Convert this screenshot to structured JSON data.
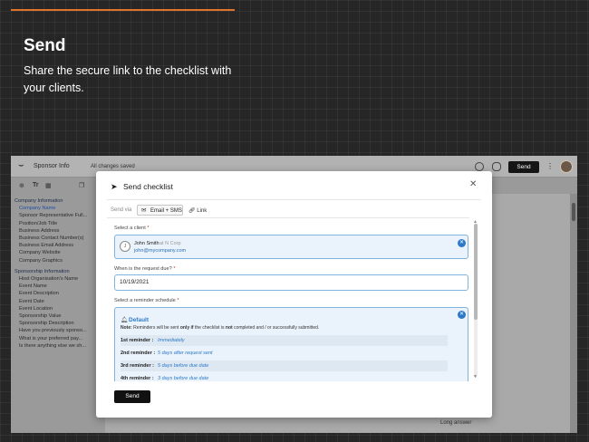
{
  "hero": {
    "title": "Send",
    "subtitle": "Share the secure link to the checklist with your clients."
  },
  "colors": {
    "accent": "#e0732c",
    "primary_blue": "#2d79c7"
  },
  "app": {
    "doc_title": "Sponsor Info",
    "saved_status": "All changes saved",
    "send_label": "Send",
    "menu_icon": "kebab-icon",
    "toolbar": {
      "text_tool": "Tr"
    }
  },
  "sidebar": {
    "sections": [
      {
        "title": "Company Information",
        "items": [
          "Company Name",
          "Sponsor Representative Full...",
          "Position/Job Title",
          "Business Address",
          "Business Contact Number(s)",
          "Business Email Address",
          "Company Website",
          "Company Graphics"
        ]
      },
      {
        "title": "Sponsorship Information",
        "items": [
          "Host Organisation's Name",
          "Event Name",
          "Event Description",
          "Event Date",
          "Event Location",
          "Sponsorship Value",
          "Sponsorship Description",
          "Have you previously sponso...",
          "What is your preferred pay...",
          "Is there anything else we sh..."
        ]
      }
    ]
  },
  "background": {
    "long_answer": "Long answer"
  },
  "modal": {
    "title": "Send checklist",
    "send_via_label": "Send via",
    "tabs": {
      "email_sms": "Email + SMS",
      "link": "Link"
    },
    "client": {
      "label": "Select a client",
      "required": "*",
      "name": "John Smith",
      "company": "at N Corp",
      "email": "john@mycompany.com",
      "avatar_initial": "J"
    },
    "due": {
      "label": "When is the request due?",
      "required": "*",
      "value": "10/19/2021"
    },
    "schedule": {
      "label": "Select a reminder schedule",
      "required": "*",
      "name": "Default",
      "note_prefix": "Note:",
      "note_text_1": "Reminders will be sent",
      "note_only": "only if",
      "note_text_2": "the checklist is",
      "note_not": "not",
      "note_text_3": "completed and / or successfully submitted.",
      "reminders": [
        {
          "label": "1st reminder :",
          "value": "Immediately"
        },
        {
          "label": "2nd reminder :",
          "value": "5 days  after  request sent"
        },
        {
          "label": "3rd reminder :",
          "value": "5 days  before  due date"
        },
        {
          "label": "4th reminder :",
          "value": "3 days  before  due date"
        }
      ]
    },
    "send_label": "Send"
  }
}
